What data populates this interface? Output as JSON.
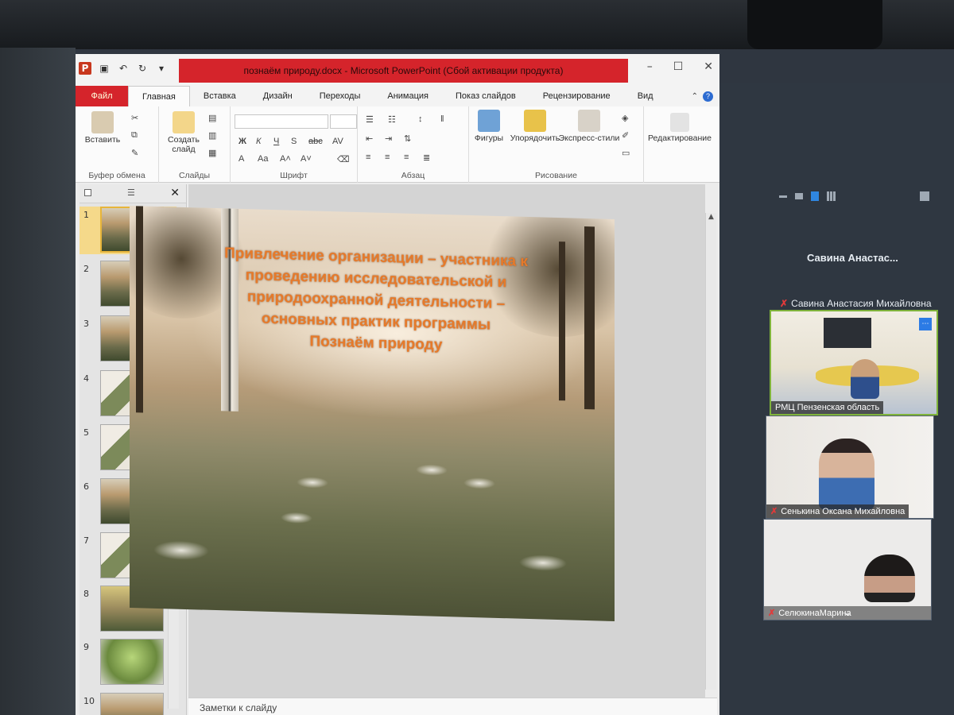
{
  "window": {
    "title": "познаём природу.docx  -  Microsoft PowerPoint (Сбой активации продукта)"
  },
  "tabs": {
    "file": "Файл",
    "home": "Главная",
    "insert": "Вставка",
    "design": "Дизайн",
    "transitions": "Переходы",
    "animations": "Анимация",
    "slideshow": "Показ слайдов",
    "review": "Рецензирование",
    "view": "Вид"
  },
  "ribbon": {
    "paste": "Вставить",
    "new_slide": "Создать\nслайд",
    "clipboard_group": "Буфер обмена",
    "slides_group": "Слайды",
    "font_group": "Шрифт",
    "paragraph_group": "Абзац",
    "drawing_group": "Рисование",
    "shapes": "Фигуры",
    "arrange": "Упорядочить",
    "quick_styles": "Экспресс-стили",
    "editing": "Редактирование"
  },
  "slides_pane": {
    "numbers": [
      "1",
      "2",
      "3",
      "4",
      "5",
      "6",
      "7",
      "8",
      "9",
      "10"
    ],
    "selected": "1"
  },
  "slide": {
    "title_lines": [
      "Привлечение организации – участника к",
      "проведению исследовательской и",
      "природоохранной деятельности –",
      "основных практик программы",
      "Познаём природу"
    ]
  },
  "notes_placeholder": "Заметки к слайду",
  "conference": {
    "host_name": "Савина  Анастас...",
    "speaker_line": "Савина Анастасия Михайловна",
    "tiles": [
      {
        "label": "РМЦ Пензенская область"
      },
      {
        "label": "Сенькина Оксана Михайловна"
      },
      {
        "label": "СелюкинаМарина"
      }
    ]
  },
  "colors": {
    "title_bar_red": "#d5242b",
    "slide_title_orange": "#e67a2a",
    "conference_bg": "#2f3741",
    "active_speaker_border": "#7fb33b"
  }
}
